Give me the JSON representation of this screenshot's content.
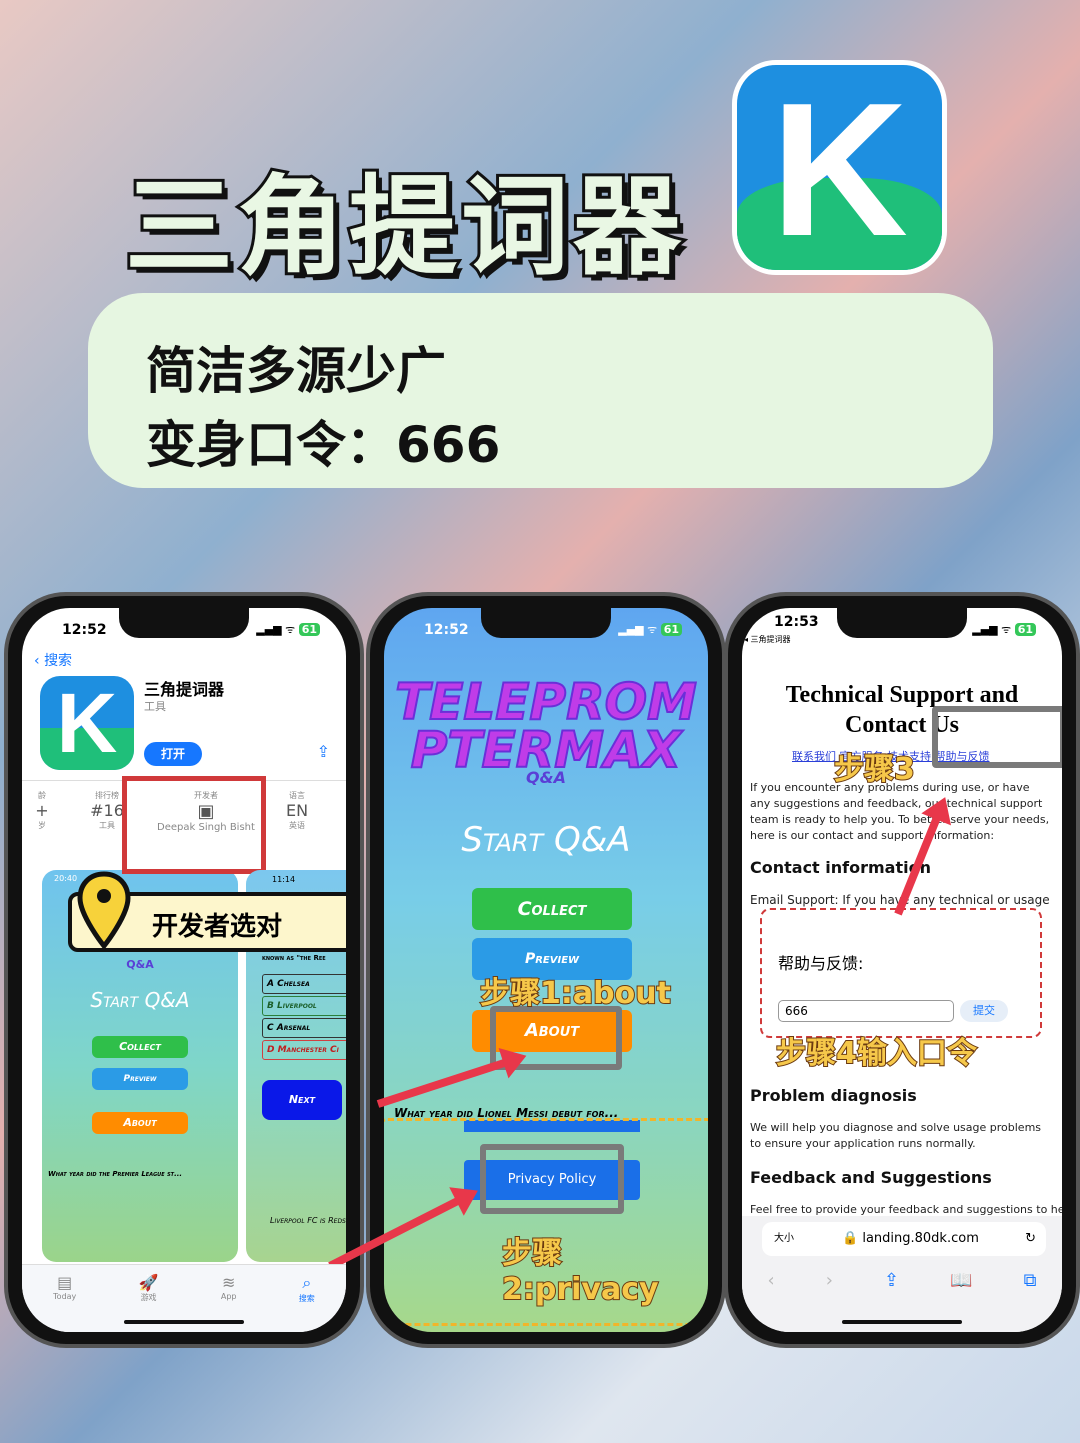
{
  "header": {
    "title": "三角提词器",
    "line1": "简洁多源少广",
    "line2": "变身口令：666",
    "icon": "k-app-icon"
  },
  "phone1": {
    "time": "12:52",
    "battery": "61",
    "back": "搜索",
    "app_name": "三角提词器",
    "category": "工具",
    "open": "打开",
    "stats": [
      {
        "label": "龄",
        "value": "+",
        "sub": "岁"
      },
      {
        "label": "排行榜",
        "value": "#16",
        "sub": "工具"
      },
      {
        "label": "开发者",
        "value": "",
        "sub": "Deepak Singh Bisht"
      },
      {
        "label": "语言",
        "value": "EN",
        "sub": "英语"
      }
    ],
    "callout": "开发者选对",
    "shot1": {
      "time": "20:40",
      "subtitle": "Q&A",
      "start": "Start Q&A",
      "collect": "Collect",
      "preview": "Preview",
      "about": "About",
      "question": "What year did the Premier League st..."
    },
    "shot2": {
      "time": "11:14",
      "header": "known as \"the Ree",
      "options": [
        "A Chelsea",
        "B Liverpool",
        "C Arsenal",
        "D Manchester Ci"
      ],
      "next": "Next",
      "footer": "Liverpool FC is Reds' due to the"
    },
    "tabs": [
      "Today",
      "游戏",
      "App",
      "搜索"
    ]
  },
  "phone2": {
    "time": "12:52",
    "battery": "61",
    "logo1": "TELEPROM",
    "logo2": "PTERMAX",
    "subtitle": "Q&A",
    "start": "Start Q&A",
    "collect": "Collect",
    "preview": "Preview",
    "about": "About",
    "question": "What year did Lionel Messi debut for...",
    "privacy": "Privacy Policy",
    "step1": "步骤1:about",
    "step2": "步骤2:privacy"
  },
  "phone3": {
    "time": "12:53",
    "back": "◂ 三角提词器",
    "battery": "61",
    "title": "Technical Support and Contact Us",
    "links": [
      "联系我们",
      "官方服务",
      "技术支持",
      "帮助与反馈"
    ],
    "intro": "If you encounter any problems during use, or have any suggestions and feedback, our technical support team is ready to help you. To better serve your needs, here is our contact and support information:",
    "h1": "Contact information",
    "email": "Email Support: If you have any technical or usage",
    "dialog_title": "帮助与反馈:",
    "input_value": "666",
    "submit": "提交",
    "h2": "Problem diagnosis",
    "p2": "We will help you diagnose and solve usage problems to ensure your application runs normally.",
    "h3": "Feedback and Suggestions",
    "p3": "Feel free to provide your feedback and suggestions to help",
    "text_size": "大小",
    "url": "landing.80dk.com",
    "step3": "步骤3",
    "step4": "步骤4输入口令"
  },
  "colors": {
    "red": "#e8374a",
    "step": "#f6c84a",
    "panel": "#e6f6e1",
    "ios_blue": "#1677ff"
  }
}
